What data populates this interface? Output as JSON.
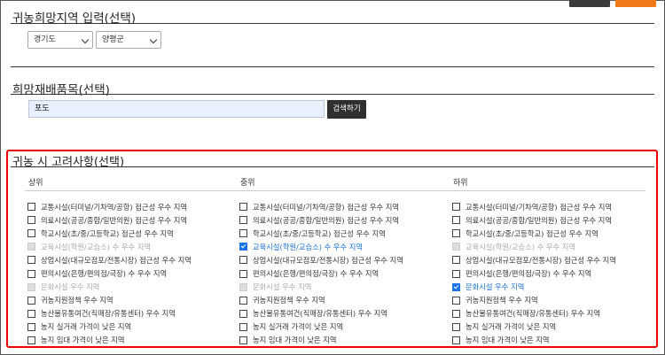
{
  "top_buttons": [
    "",
    ""
  ],
  "region": {
    "title": "귀농희망지역 입력(선택)",
    "province": "경기도",
    "county": "양평군"
  },
  "crop": {
    "title": "희망재배품목(선택)",
    "value": "포도",
    "search_label": "검색하기"
  },
  "priorities": {
    "title": "귀농 시 고려사항(선택)",
    "columns": [
      {
        "header": "상위",
        "items": [
          {
            "label": "교통시설(터미널/기차역/공항) 접근성 우수 지역",
            "state": "unchecked"
          },
          {
            "label": "의료시설(공공/종합/일반의원) 접근성 우수 지역",
            "state": "unchecked"
          },
          {
            "label": "학교시설(초/중/고등학교) 접근성 우수 지역",
            "state": "unchecked"
          },
          {
            "label": "교육시설(학원/교습소) 수 우수 지역",
            "state": "disabled"
          },
          {
            "label": "상업시설(대규모점포/전통시장) 접근성 우수 지역",
            "state": "unchecked"
          },
          {
            "label": "편의시설(은행/편의점/극장) 수 우수 지역",
            "state": "unchecked"
          },
          {
            "label": "문화시설 우수 지역",
            "state": "disabled"
          },
          {
            "label": "귀농지원정책 우수 지역",
            "state": "unchecked"
          },
          {
            "label": "농산물유통여건(직매장/유통센터) 우수 지역",
            "state": "unchecked"
          },
          {
            "label": "농지 실거래 가격이 낮은 지역",
            "state": "unchecked"
          },
          {
            "label": "농지 임대 가격이 낮은 지역",
            "state": "unchecked"
          }
        ]
      },
      {
        "header": "중위",
        "items": [
          {
            "label": "교통시설(터미널/기차역/공항) 접근성 우수 지역",
            "state": "unchecked"
          },
          {
            "label": "의료시설(공공/종합/일반의원) 접근성 우수 지역",
            "state": "unchecked"
          },
          {
            "label": "학교시설(초/중/고등학교) 접근성 우수 지역",
            "state": "unchecked"
          },
          {
            "label": "교육시설(학원/교습소) 수 우수 지역",
            "state": "checked"
          },
          {
            "label": "상업시설(대규모점포/전통시장) 접근성 우수 지역",
            "state": "unchecked"
          },
          {
            "label": "편의시설(은행/편의점/극장) 수 우수 지역",
            "state": "unchecked"
          },
          {
            "label": "문화시설 우수 지역",
            "state": "disabled"
          },
          {
            "label": "귀농지원정책 우수 지역",
            "state": "unchecked"
          },
          {
            "label": "농산물유통여건(직매장/유통센터) 우수 지역",
            "state": "unchecked"
          },
          {
            "label": "농지 실거래 가격이 낮은 지역",
            "state": "unchecked"
          },
          {
            "label": "농지 임대 가격이 낮은 지역",
            "state": "unchecked"
          }
        ]
      },
      {
        "header": "하위",
        "items": [
          {
            "label": "교통시설(터미널/기차역/공항) 접근성 우수 지역",
            "state": "unchecked"
          },
          {
            "label": "의료시설(공공/종합/일반의원) 접근성 우수 지역",
            "state": "unchecked"
          },
          {
            "label": "학교시설(초/중/고등학교) 접근성 우수 지역",
            "state": "unchecked"
          },
          {
            "label": "교육시설(학원/교습소) 수 우수 지역",
            "state": "disabled"
          },
          {
            "label": "상업시설(대규모점포/전통시장) 접근성 우수 지역",
            "state": "unchecked"
          },
          {
            "label": "편의시설(은행/편의점/극장) 수 우수 지역",
            "state": "unchecked"
          },
          {
            "label": "문화시설 우수 지역",
            "state": "checked"
          },
          {
            "label": "귀농지원정책 우수 지역",
            "state": "unchecked"
          },
          {
            "label": "농산물유통여건(직매장/유통센터) 우수 지역",
            "state": "unchecked"
          },
          {
            "label": "농지 실거래 가격이 낮은 지역",
            "state": "unchecked"
          },
          {
            "label": "농지 임대 가격이 낮은 지역",
            "state": "unchecked"
          }
        ]
      }
    ]
  },
  "colors": {
    "highlight_border": "#e00000",
    "checked_accent": "#1a73e8",
    "top_button_orange": "#f07a1a",
    "top_button_dark": "#3b3b3b"
  }
}
